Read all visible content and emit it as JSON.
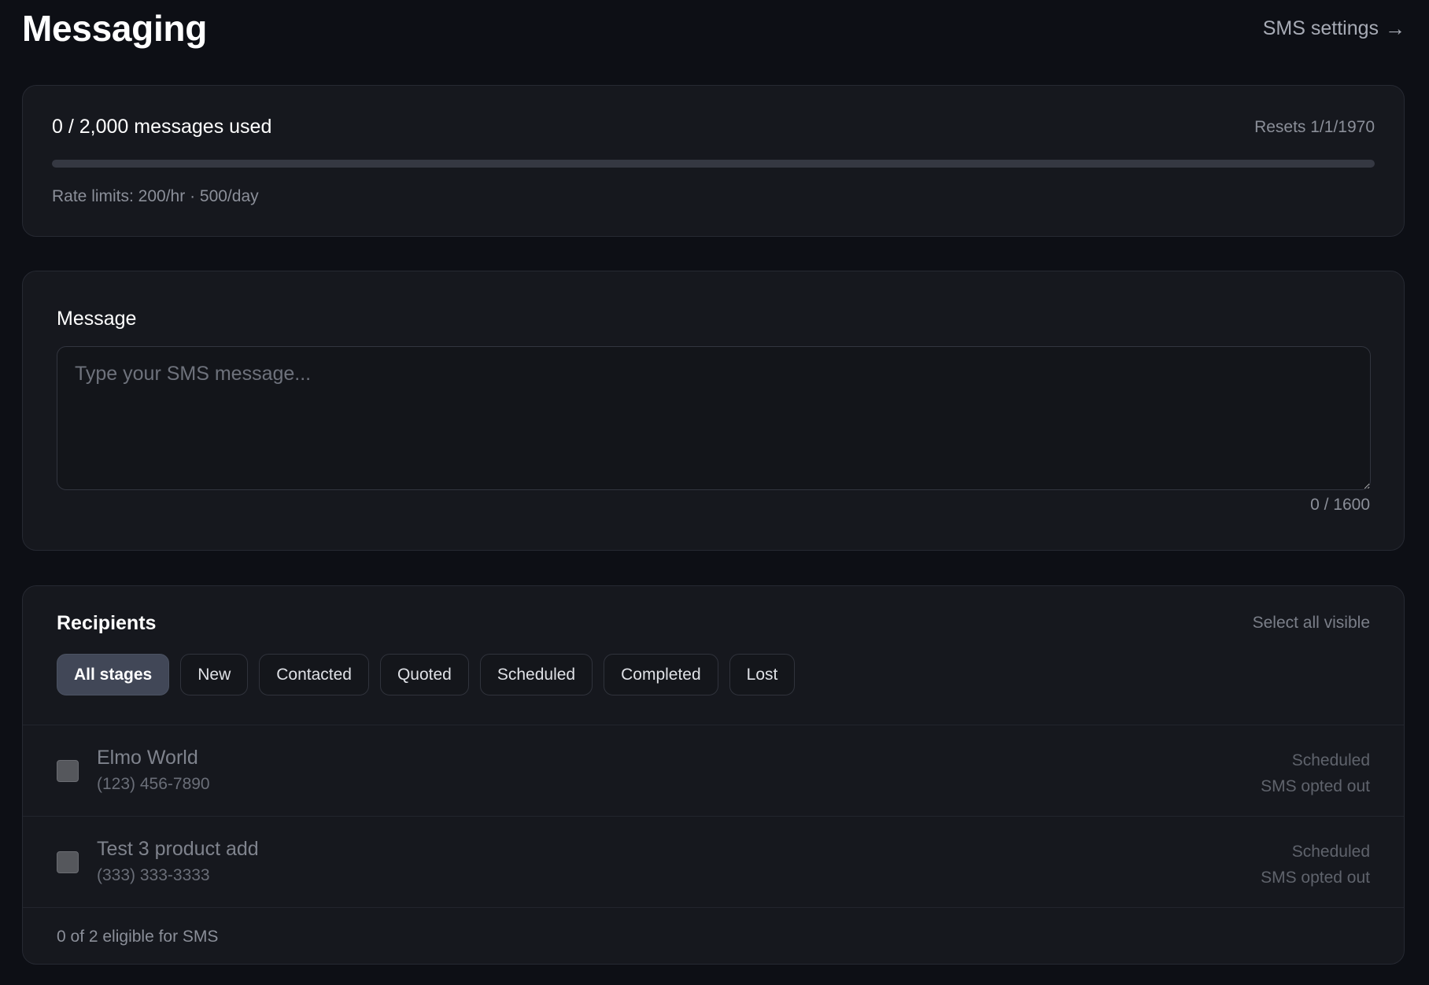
{
  "header": {
    "title": "Messaging",
    "settings_link": "SMS settings",
    "settings_arrow": "→"
  },
  "usage": {
    "summary": "0 / 2,000 messages used",
    "resets": "Resets 1/1/1970",
    "progress_fraction": 0,
    "rate_limits": "Rate limits: 200/hr · 500/day",
    "accent_color": "#6b8cff"
  },
  "message": {
    "label": "Message",
    "placeholder": "Type your SMS message...",
    "value": "",
    "char_count": "0 / 1600"
  },
  "recipients": {
    "title": "Recipients",
    "select_all": "Select all visible",
    "stages": [
      {
        "label": "All stages",
        "active": true
      },
      {
        "label": "New",
        "active": false
      },
      {
        "label": "Contacted",
        "active": false
      },
      {
        "label": "Quoted",
        "active": false
      },
      {
        "label": "Scheduled",
        "active": false
      },
      {
        "label": "Completed",
        "active": false
      },
      {
        "label": "Lost",
        "active": false
      }
    ],
    "rows": [
      {
        "name": "Elmo World",
        "phone": "(123) 456-7890",
        "stage": "Scheduled",
        "status": "SMS opted out",
        "checked": false
      },
      {
        "name": "Test 3 product add",
        "phone": "(333) 333-3333",
        "stage": "Scheduled",
        "status": "SMS opted out",
        "checked": false
      }
    ],
    "eligible": "0 of 2 eligible for SMS"
  }
}
